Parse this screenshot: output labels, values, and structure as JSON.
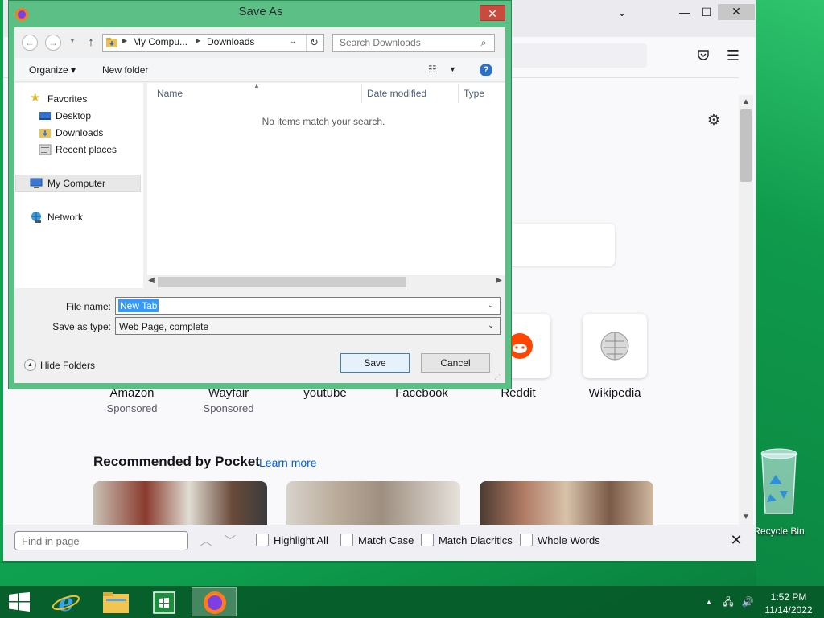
{
  "desktop": {
    "recycle_bin_label": "Recycle Bin"
  },
  "firefox": {
    "window_controls": {
      "minimize": "—",
      "maximize": "☐",
      "close": "✕",
      "tabs_menu": "⌄"
    },
    "top_sites": [
      {
        "name": "Amazon",
        "sub": "Sponsored"
      },
      {
        "name": "Wayfair",
        "sub": "Sponsored"
      },
      {
        "name": "youtube",
        "sub": ""
      },
      {
        "name": "Facebook",
        "sub": ""
      },
      {
        "name": "Reddit",
        "sub": ""
      },
      {
        "name": "Wikipedia",
        "sub": ""
      }
    ],
    "pocket": {
      "title": "Recommended by Pocket",
      "learn_more": "Learn more"
    },
    "findbar": {
      "placeholder": "Find in page",
      "highlight_all": "Highlight All",
      "match_case": "Match Case",
      "match_diacritics": "Match Diacritics",
      "whole_words": "Whole Words"
    }
  },
  "dialog": {
    "title": "Save As",
    "close": "✕",
    "address": {
      "crumb1": "My Compu...",
      "crumb2": "Downloads"
    },
    "search_placeholder": "Search Downloads",
    "toolbar": {
      "organize": "Organize",
      "new_folder": "New folder"
    },
    "nav": {
      "favorites": "Favorites",
      "desktop": "Desktop",
      "downloads": "Downloads",
      "recent": "Recent places",
      "my_computer": "My Computer",
      "network": "Network"
    },
    "columns": {
      "name": "Name",
      "date_modified": "Date modified",
      "type": "Type"
    },
    "empty_message": "No items match your search.",
    "file_name_label": "File name:",
    "file_name_value": "New Tab",
    "save_type_label": "Save as type:",
    "save_type_value": "Web Page, complete",
    "hide_folders": "Hide Folders",
    "save_button": "Save",
    "cancel_button": "Cancel"
  },
  "taskbar": {
    "time": "1:52 PM",
    "date": "11/14/2022"
  },
  "colors": {
    "desktop_green": "#0e9e4e",
    "dialog_frame": "#5cbf86",
    "close_red": "#c74b3e",
    "link_blue": "#0061e0",
    "selection_blue": "#3399ff"
  }
}
